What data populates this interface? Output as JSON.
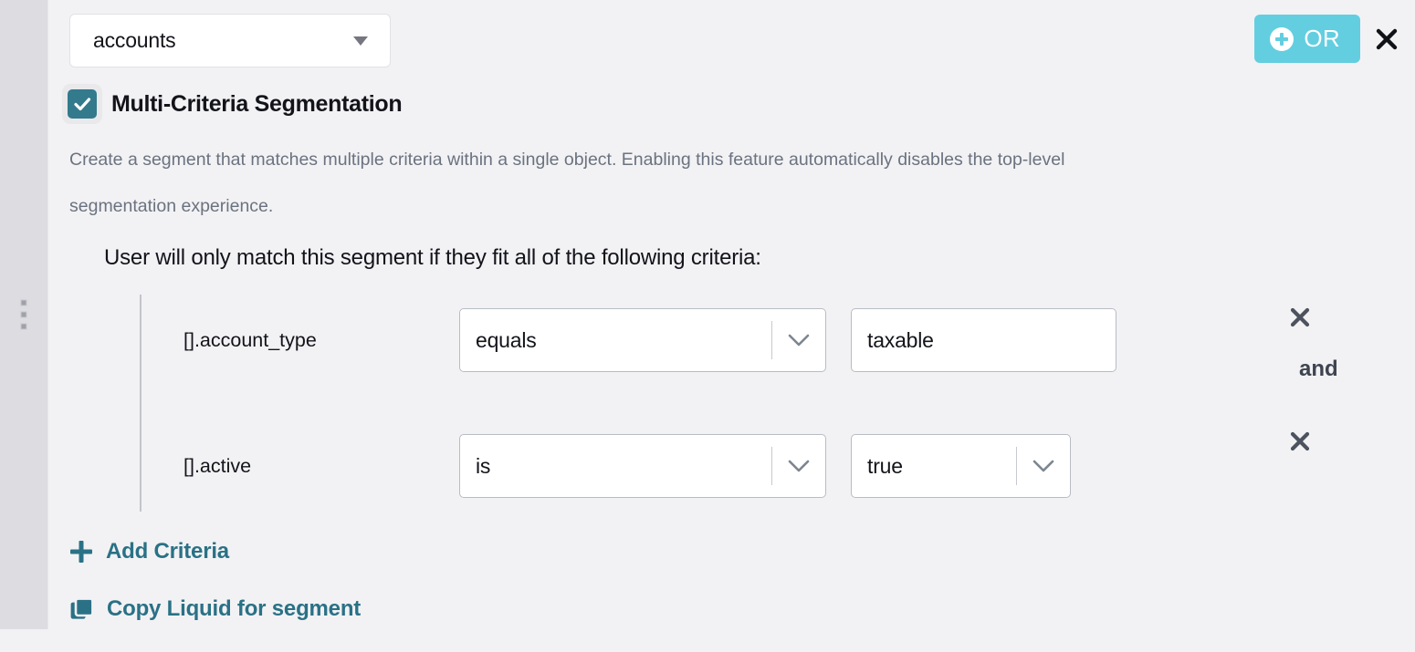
{
  "sidebar": {
    "drag_handle_icon": "drag-handle-icon",
    "dot_count": 3
  },
  "header": {
    "object_select": {
      "value": "accounts",
      "caret_icon": "caret-down-icon"
    },
    "or_button": {
      "label": "OR",
      "icon": "plus-circle-icon"
    },
    "close_button": {
      "icon": "close-icon"
    }
  },
  "feature_toggle": {
    "checked": true,
    "check_icon": "check-icon",
    "label": "Multi-Criteria Segmentation",
    "description": "Create a segment that matches multiple criteria within a single object. Enabling this feature automatically disables the top-level segmentation experience."
  },
  "criteria_section": {
    "heading": "User will only match this segment if they fit all of the following criteria:",
    "conjunction": "and",
    "remove_icon": "close-icon",
    "chevron_icon": "chevron-down-icon",
    "rows": [
      {
        "field": "[].account_type",
        "operator": "equals",
        "value": "taxable",
        "value_control": "text"
      },
      {
        "field": "[].active",
        "operator": "is",
        "value": "true",
        "value_control": "select"
      }
    ]
  },
  "actions": {
    "add_criteria": {
      "label": "Add Criteria",
      "icon": "plus-icon"
    },
    "copy_liquid": {
      "label": "Copy Liquid for segment",
      "icon": "copy-icon"
    }
  },
  "colors": {
    "accent_teal": "#2a7186",
    "checkbox_teal": "#337a8c",
    "or_blue": "#63cee0",
    "background": "#f2f2f4",
    "rail": "#dcdce1"
  }
}
